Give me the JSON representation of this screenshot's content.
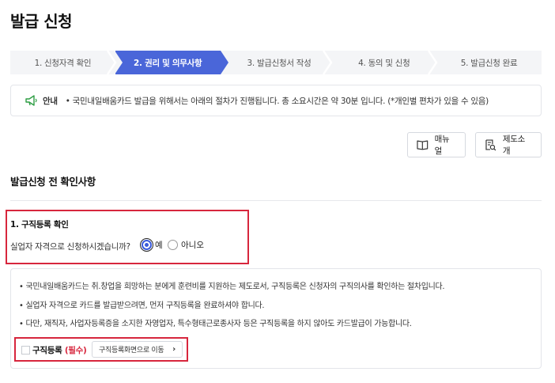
{
  "page": {
    "title": "발급 신청"
  },
  "steps": [
    {
      "label": "1. 신청자격 확인",
      "active": false
    },
    {
      "label": "2. 권리 및 의무사항",
      "active": true
    },
    {
      "label": "3. 발급신청서 작성",
      "active": false
    },
    {
      "label": "4. 동의 및 신청",
      "active": false
    },
    {
      "label": "5. 발급신청 완료",
      "active": false
    }
  ],
  "notice": {
    "icon": "speaker-icon",
    "label": "안내",
    "text": "• 국민내일배움카드 발급을 위해서는 아래의 절차가 진행됩니다. 총 소요시간은 약 30분 입니다. (*개인별 편차가 있을 수 있음)"
  },
  "buttons": {
    "manual": {
      "label": "매뉴얼",
      "icon": "book-icon"
    },
    "intro": {
      "label": "제도소개",
      "icon": "document-search-icon"
    }
  },
  "section": {
    "title": "발급신청 전 확인사항"
  },
  "question": {
    "title": "1. 구직등록 확인",
    "text": "실업자 자격으로 신청하시겠습니까?",
    "options": [
      {
        "label": "예",
        "checked": true
      },
      {
        "label": "아니오",
        "checked": false
      }
    ]
  },
  "info": {
    "bullets": [
      "• 국민내일배움카드는 취.창업을 희망하는 분에게 훈련비를 지원하는 제도로서, 구직등록은 신청자의 구직의사를 확인하는 절차입니다.",
      "• 실업자 자격으로 카드를 발급받으려면, 먼저 구직등록을 완료하셔야 합니다.",
      "• 다만, 재직자, 사업자등록증을 소지한 자영업자, 특수형태근로종사자 등은 구직등록을 하지 않아도 카드발급이 가능합니다."
    ]
  },
  "registration": {
    "label": "구직등록",
    "required": "(필수)",
    "checked": false,
    "button_label": "구직등록화면으로 이동",
    "button_arrow": "›"
  },
  "colors": {
    "accent": "#4a66d9",
    "highlight": "#d7263d",
    "radio": "#3b5bdb"
  }
}
